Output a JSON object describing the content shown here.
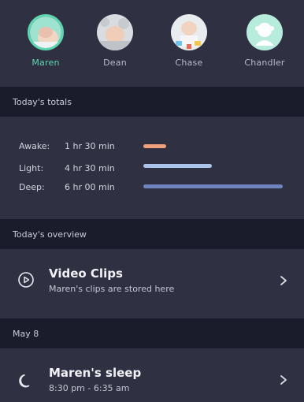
{
  "profiles": [
    {
      "name": "Maren",
      "selected": true
    },
    {
      "name": "Dean",
      "selected": false
    },
    {
      "name": "Chase",
      "selected": false
    },
    {
      "name": "Chandler",
      "selected": false
    }
  ],
  "totals": {
    "header": "Today's totals",
    "rows": [
      {
        "label": "Awake:",
        "value": "1 hr 30 min",
        "fraction": 0.16,
        "color": "#f0a17c"
      },
      {
        "label": "Light:",
        "value": "4 hr 30 min",
        "fraction": 0.48,
        "color": "#a9c3ea"
      },
      {
        "label": "Deep:",
        "value": "6 hr 00 min",
        "fraction": 0.97,
        "color": "#6f83bf"
      }
    ]
  },
  "overview": {
    "header": "Today's overview",
    "video_clips": {
      "title": "Video Clips",
      "subtitle": "Maren's clips are stored here",
      "icon": "play-circle-icon"
    }
  },
  "date_section": {
    "header": "May 8",
    "sleep_item": {
      "title": "Maren's sleep",
      "subtitle": "8:30 pm - 6:35 am",
      "icon": "moon-icon"
    }
  },
  "colors": {
    "accent": "#5ed6b0",
    "background": "#2f3142",
    "section_header": "#1b1c2b"
  }
}
